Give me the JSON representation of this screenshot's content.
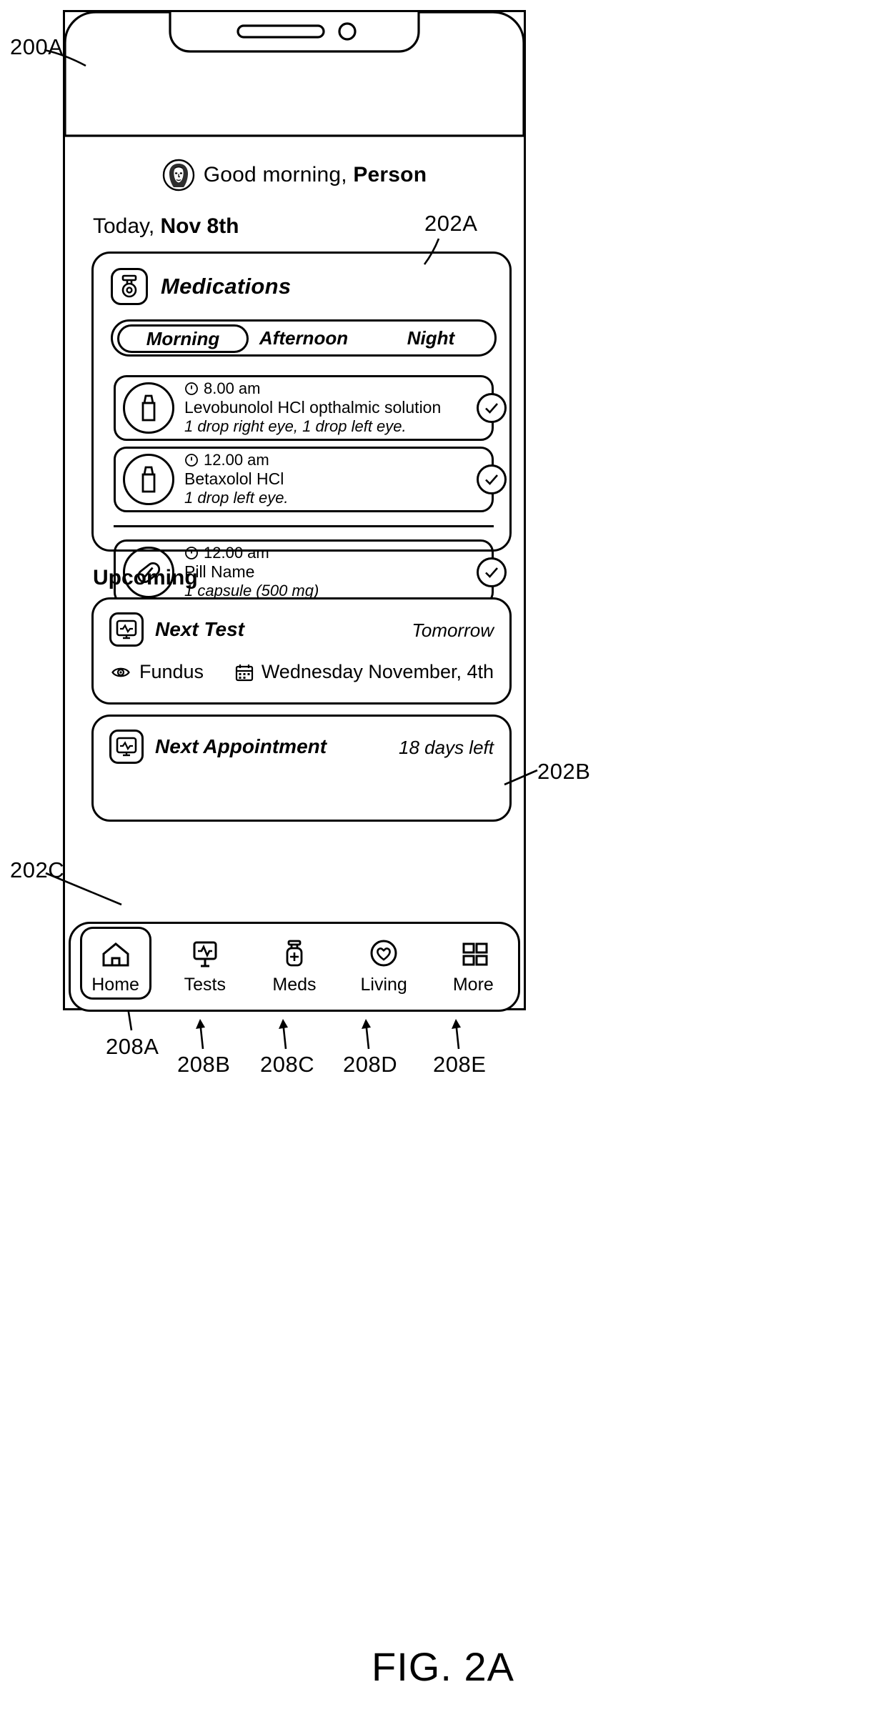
{
  "figure": {
    "caption": "FIG. 2A",
    "refs": {
      "device": "200A",
      "medications_card": "202A",
      "next_test_card": "202B",
      "next_appointment_card": "202C",
      "tab_home": "208A",
      "tab_tests": "208B",
      "tab_meds": "208C",
      "tab_living": "208D",
      "tab_more": "208E"
    }
  },
  "header": {
    "avatar_icon": "user-avatar-icon",
    "greeting_prefix": "Good morning, ",
    "greeting_name": "Person",
    "today_prefix": "Today, ",
    "today_date": "Nov 8th"
  },
  "medications": {
    "icon": "medicine-dropper-icon",
    "title": "Medications",
    "tabs": [
      {
        "label": "Morning",
        "active": true
      },
      {
        "label": "Afternoon",
        "active": false
      },
      {
        "label": "Night",
        "active": false
      }
    ],
    "items": [
      {
        "icon": "eye-drop-bottle-icon",
        "time_icon": "clock-icon",
        "time": "8.00 am",
        "name": "Levobunolol HCl opthalmic solution",
        "dose": "1 drop right eye, 1 drop left eye.",
        "check_icon": "check-circle-icon"
      },
      {
        "icon": "eye-drop-bottle-icon",
        "time_icon": "clock-icon",
        "time": "12.00 am",
        "name": "Betaxolol HCl",
        "dose": "1 drop left eye.",
        "check_icon": "check-circle-icon"
      },
      {
        "icon": "capsule-icon",
        "time_icon": "clock-icon",
        "time": "12.00 am",
        "name": "Pill Name",
        "dose": "1 capsule (500 mg)",
        "check_icon": "check-circle-icon"
      }
    ]
  },
  "upcoming": {
    "section_title": "Upcoming",
    "next_test": {
      "icon": "monitor-waveform-icon",
      "title": "Next Test",
      "when": "Tomorrow",
      "detail_icon": "eye-icon",
      "detail_label": "Fundus",
      "date_icon": "calendar-icon",
      "date_label": "Wednesday November, 4th"
    },
    "next_appointment": {
      "icon": "monitor-waveform-icon",
      "title": "Next Appointment",
      "when": "18 days left"
    }
  },
  "tabbar": {
    "items": [
      {
        "icon": "home-icon",
        "label": "Home",
        "active": true
      },
      {
        "icon": "monitor-waveform-icon",
        "label": "Tests",
        "active": false
      },
      {
        "icon": "medicine-bottle-plus-icon",
        "label": "Meds",
        "active": false
      },
      {
        "icon": "heart-shield-icon",
        "label": "Living",
        "active": false
      },
      {
        "icon": "grid-squares-icon",
        "label": "More",
        "active": false
      }
    ]
  }
}
